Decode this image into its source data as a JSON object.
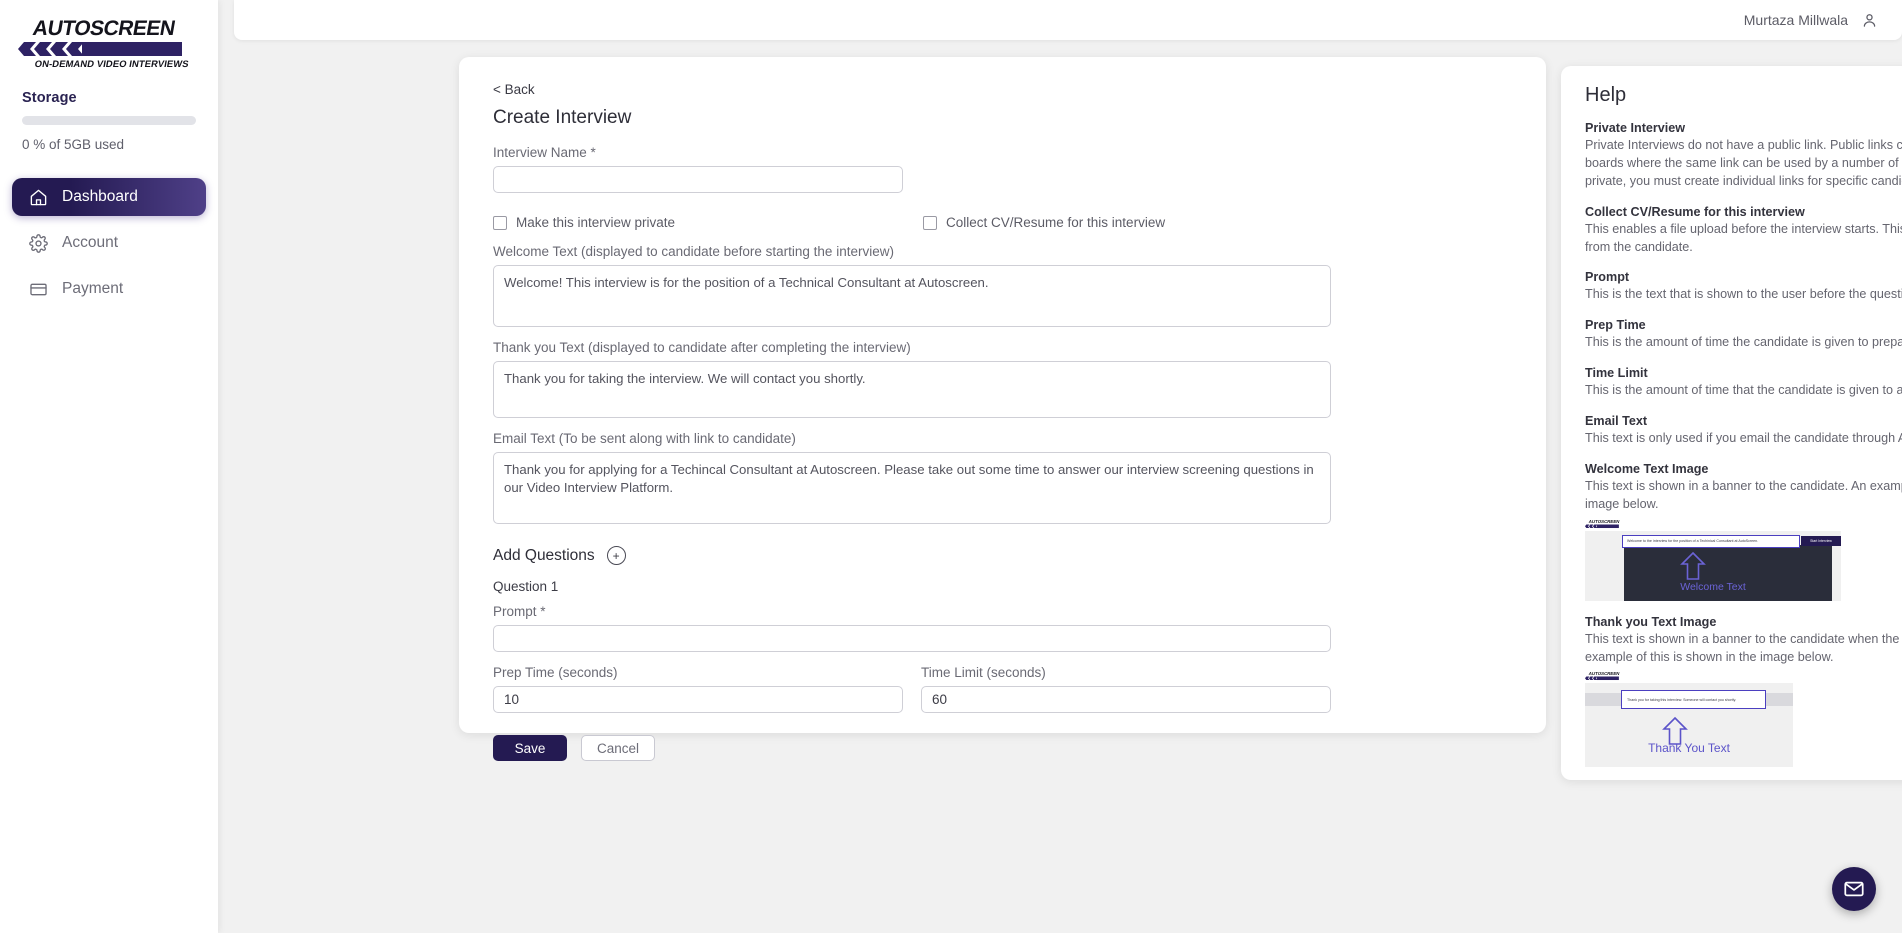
{
  "brand": {
    "name": "AUTOSCREEN",
    "tagline": "ON-DEMAND VIDEO INTERVIEWS",
    "primary_color": "#241a52",
    "accent_color": "#4f4088"
  },
  "sidebar": {
    "storage": {
      "title": "Storage",
      "used_percent": 0,
      "caption": "0 % of 5GB used"
    },
    "items": [
      {
        "label": "Dashboard",
        "icon": "home-icon",
        "active": true
      },
      {
        "label": "Account",
        "icon": "gear-icon",
        "active": false
      },
      {
        "label": "Payment",
        "icon": "card-icon",
        "active": false
      }
    ]
  },
  "topbar": {
    "user_name": "Murtaza Millwala",
    "user_icon": "person-icon"
  },
  "form": {
    "back_label": "< Back",
    "title": "Create Interview",
    "interview_name": {
      "label": "Interview Name *",
      "value": "",
      "placeholder": ""
    },
    "checkboxes": [
      {
        "label": "Make this interview private",
        "checked": false
      },
      {
        "label": "Collect CV/Resume for this interview",
        "checked": false
      }
    ],
    "welcome_text": {
      "label": "Welcome Text (displayed to candidate before starting the interview)",
      "value": "Welcome! This interview is for the position of a Technical Consultant at Autoscreen."
    },
    "thankyou_text": {
      "label": "Thank you Text (displayed to candidate after completing the interview)",
      "value": "Thank you for taking the interview. We will contact you shortly."
    },
    "email_text": {
      "label": "Email Text (To be sent along with link to candidate)",
      "value": "Thank you for applying for a Techincal Consultant at Autoscreen. Please take out some time to answer our interview screening questions in our Video Interview Platform."
    },
    "add_questions": {
      "label": "Add Questions",
      "button_glyph": "+"
    },
    "question": {
      "title": "Question 1",
      "prompt_label": "Prompt *",
      "prompt_value": "",
      "prep_time_label": "Prep Time (seconds)",
      "prep_time_value": "10",
      "time_limit_label": "Time Limit (seconds)",
      "time_limit_value": "60"
    },
    "buttons": {
      "save": "Save",
      "cancel": "Cancel"
    }
  },
  "help": {
    "title": "Help",
    "entries": [
      {
        "heading": "Private Interview",
        "body": "Private Interviews do not have a public link. Public links can be used in places like job boards where the same link can be used by a number of candidates. If an interview is private, you must create individual links for specific candidates."
      },
      {
        "heading": "Collect CV/Resume for this interview",
        "body": "This enables a file upload before the interview starts. This allows you to collect a pdf from the candidate."
      },
      {
        "heading": "Prompt",
        "body": "This is the text that is shown to the user before the question is started."
      },
      {
        "heading": "Prep Time",
        "body": "This is the amount of time the candidate is given to prepare an answer."
      },
      {
        "heading": "Time Limit",
        "body": "This is the amount of time that the candidate is given to answer the question."
      },
      {
        "heading": "Email Text",
        "body": "This text is only used if you email the candidate through Autoscreen."
      },
      {
        "heading": "Welcome Text Image",
        "body": "This text is shown in a banner to the candidate. An example of this is shown in the image below."
      },
      {
        "heading": "Thank you Text Image",
        "body": "This text is shown in a banner to the candidate when the interview is completed. An example of this is shown in the image below."
      }
    ],
    "welcome_example": {
      "banner_text": "Welcome to the interview for the position of a Techinical Consultant at AutoScreen.",
      "button_text": "Start Interview",
      "caption": "Welcome Text"
    },
    "thankyou_example": {
      "banner_text": "Thank you for taking this interview. Someone will contact you shortly.",
      "caption": "Thank You Text"
    }
  },
  "fab": {
    "icon": "mail-icon"
  }
}
